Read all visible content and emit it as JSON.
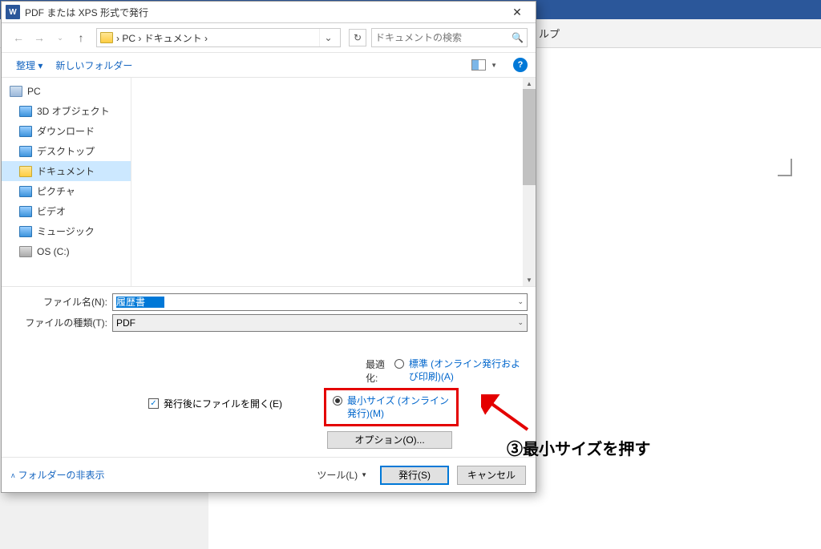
{
  "bg": {
    "help": "ルプ"
  },
  "dialog": {
    "title": "PDF または XPS 形式で発行",
    "breadcrumb": "›  PC  ›  ドキュメント  ›",
    "search_placeholder": "ドキュメントの検索",
    "toolbar": {
      "organize": "整理 ▾",
      "new_folder": "新しいフォルダー"
    },
    "tree": [
      {
        "label": "PC",
        "icon": "ic-pc",
        "root": true
      },
      {
        "label": "3D オブジェクト",
        "icon": "ic-blue"
      },
      {
        "label": "ダウンロード",
        "icon": "ic-blue"
      },
      {
        "label": "デスクトップ",
        "icon": "ic-blue"
      },
      {
        "label": "ドキュメント",
        "icon": "ic-folder",
        "selected": true
      },
      {
        "label": "ピクチャ",
        "icon": "ic-blue"
      },
      {
        "label": "ビデオ",
        "icon": "ic-blue"
      },
      {
        "label": "ミュージック",
        "icon": "ic-blue"
      },
      {
        "label": "OS (C:)",
        "icon": "ic-gray"
      }
    ],
    "form": {
      "filename_label": "ファイル名(N):",
      "filename_value": "履歴書",
      "filetype_label": "ファイルの種類(T):",
      "filetype_value": "PDF"
    },
    "options": {
      "open_after": "発行後にファイルを開く(E)",
      "optimize_label": "最適化:",
      "standard": "標準 (オンライン発行および印刷)(A)",
      "minimum": "最小サイズ (オンライン発行)(M)",
      "options_btn": "オプション(O)..."
    },
    "footer": {
      "hide_folders": "フォルダーの非表示",
      "tools": "ツール(L)",
      "publish": "発行(S)",
      "cancel": "キャンセル"
    }
  },
  "annotation": {
    "text": "③最小サイズを押す"
  }
}
